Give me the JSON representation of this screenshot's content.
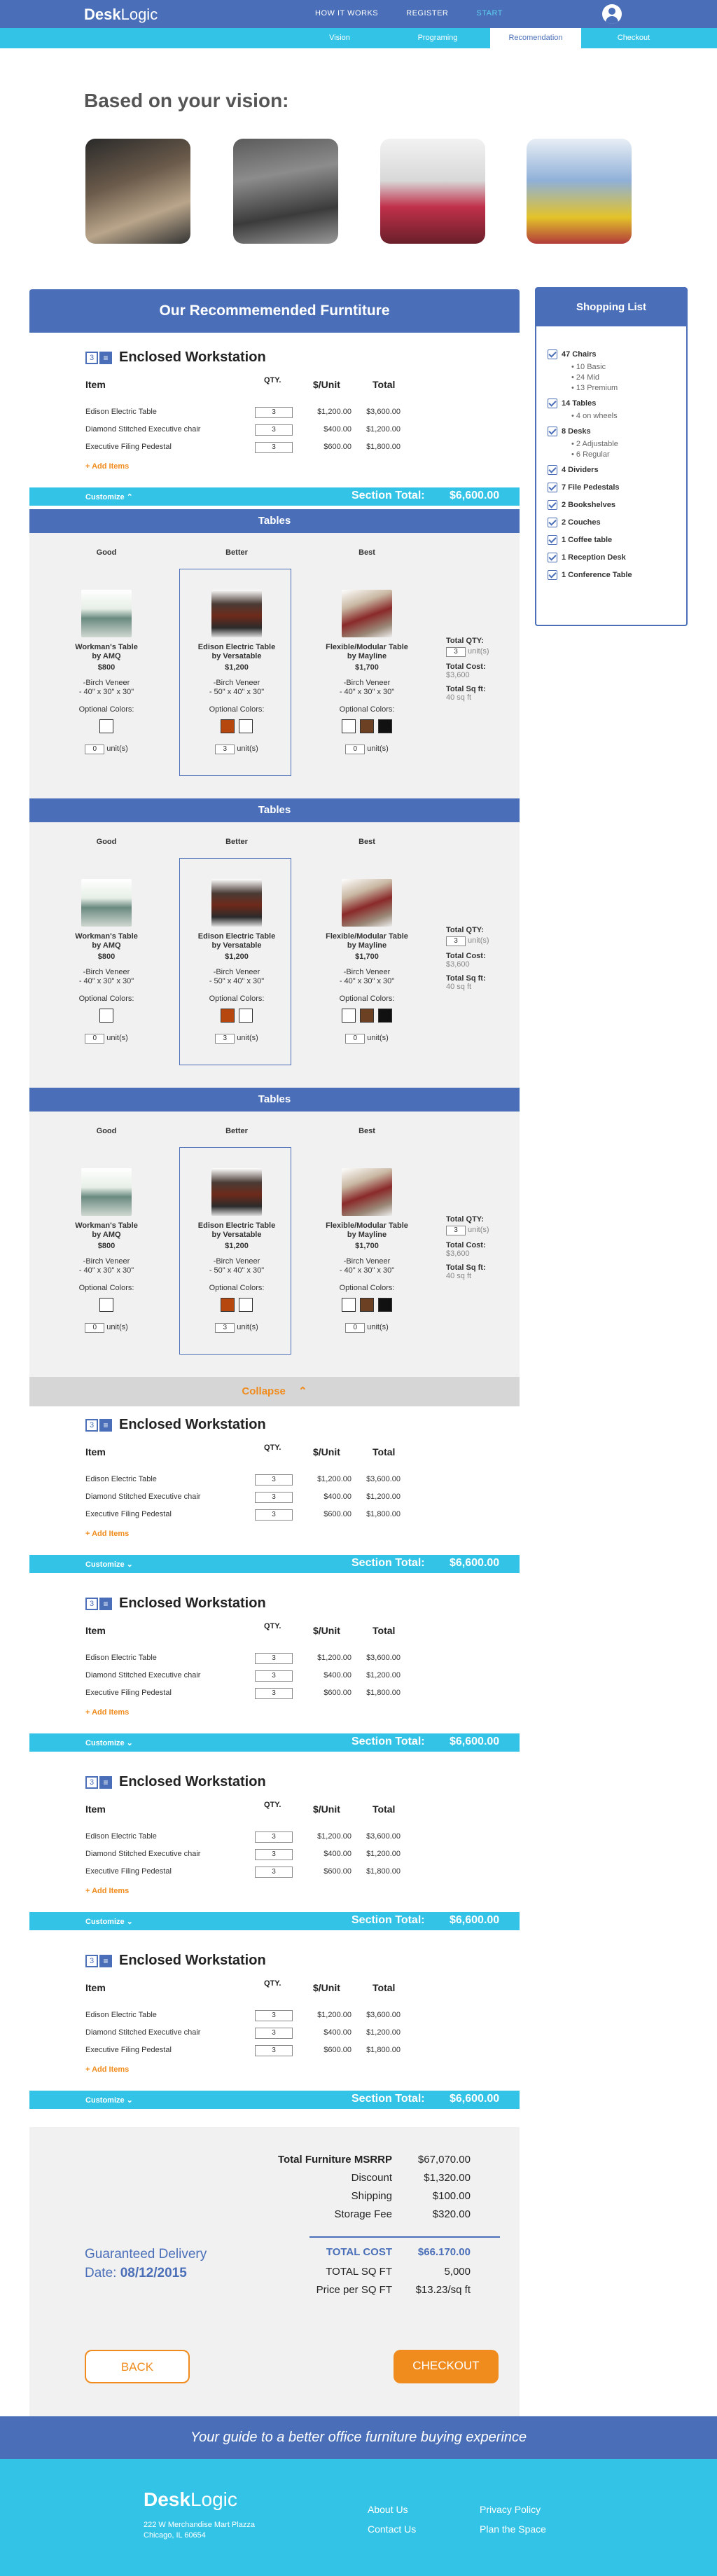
{
  "header": {
    "logo_bold": "Desk",
    "logo_rest": "Logic",
    "nav": [
      "HOW IT WORKS",
      "REGISTER",
      "START"
    ]
  },
  "steps": [
    "Vision",
    "Programing",
    "Recomendation",
    "Checkout"
  ],
  "vision": {
    "title": "Based on your vision:"
  },
  "recommend": {
    "title": "Our Recommemended Furntiture"
  },
  "workstation": {
    "qty_badge": "3",
    "title": "Enclosed Workstation",
    "headers": {
      "item": "Item",
      "qty": "QTY.",
      "unit": "$/Unit",
      "total": "Total"
    },
    "rows": [
      {
        "name": "Edison Electric Table",
        "qty": "3",
        "unit": "$1,200.00",
        "total": "$3,600.00"
      },
      {
        "name": "Diamond Stitched Executive chair",
        "qty": "3",
        "unit": "$400.00",
        "total": "$1,200.00"
      },
      {
        "name": "Executive Filing Pedestal",
        "qty": "3",
        "unit": "$600.00",
        "total": "$1,800.00"
      }
    ],
    "add": "Add Items",
    "customize": "Customize",
    "section_total_label": "Section Total:",
    "section_total": "$6,600.00"
  },
  "tables": {
    "title": "Tables",
    "options": [
      {
        "grade": "Good",
        "name1": "Workman's Table",
        "name2": "by AMQ",
        "price": "$800",
        "spec1": "-Birch Veneer",
        "spec2": "- 40\" x 30\" x 30\"",
        "colors_label": "Optional Colors:",
        "units": "0",
        "units_label": "unit(s)"
      },
      {
        "grade": "Better",
        "name1": "Edison Electric Table",
        "name2": "by Versatable",
        "price": "$1,200",
        "spec1": "-Birch Veneer",
        "spec2": "- 50\" x 40\" x 30\"",
        "colors_label": "Optional Colors:",
        "units": "3",
        "units_label": "unit(s)"
      },
      {
        "grade": "Best",
        "name1": "Flexible/Modular Table",
        "name2": "by Mayline",
        "price": "$1,700",
        "spec1": "-Birch Veneer",
        "spec2": "- 40\" x 30\" x 30\"",
        "colors_label": "Optional Colors:",
        "units": "0",
        "units_label": "unit(s)"
      }
    ],
    "totals": {
      "qty_label": "Total QTY:",
      "qty": "3",
      "qty_unit": "unit(s)",
      "cost_label": "Total Cost:",
      "cost": "$3,600",
      "sqft_label": "Total Sq ft:",
      "sqft": "40 sq ft"
    },
    "colors": {
      "brown": "#b5470f",
      "black": "#111111",
      "white": "#ffffff",
      "darkbrown": "#6b4023"
    }
  },
  "collapse": "Collapse",
  "shopping": {
    "title": "Shopping List",
    "items": [
      {
        "label": "47 Chairs",
        "subs": [
          "10 Basic",
          "24 Mid",
          "13 Premium"
        ]
      },
      {
        "label": "14 Tables",
        "subs": [
          "4 on wheels"
        ]
      },
      {
        "label": "8 Desks",
        "subs": [
          "2 Adjustable",
          "6 Regular"
        ]
      },
      {
        "label": "4 Dividers",
        "subs": []
      },
      {
        "label": "7 File Pedestals",
        "subs": []
      },
      {
        "label": "2 Bookshelves",
        "subs": []
      },
      {
        "label": "2 Couches",
        "subs": []
      },
      {
        "label": "1 Coffee table",
        "subs": []
      },
      {
        "label": "1 Reception Desk",
        "subs": []
      },
      {
        "label": "1 Conference Table",
        "subs": []
      }
    ]
  },
  "summary": {
    "msrp_label": "Total Furniture MSRRP",
    "msrp": "$67,070.00",
    "discount_label": "Discount",
    "discount": "$1,320.00",
    "shipping_label": "Shipping",
    "shipping": "$100.00",
    "storage_label": "Storage Fee",
    "storage": "$320.00",
    "cost_label": "TOTAL COST",
    "cost": "$66.170.00",
    "sqft_label": "TOTAL SQ FT",
    "sqft": "5,000",
    "pps_label": "Price per SQ FT",
    "pps": "$13.23/sq ft",
    "delivery_label": "Guaranteed Delivery",
    "date_label": "Date:",
    "date": "08/12/2015",
    "back": "BACK",
    "checkout": "CHECKOUT"
  },
  "footer": {
    "tagline": "Your guide to a better office furniture buying experince",
    "logo_bold": "Desk",
    "logo_rest": "Logic",
    "address1": "222 W Merchandise Mart Plazza",
    "address2": "Chicago, IL 60654",
    "links": [
      "About Us",
      "Contact Us",
      "Privacy Policy",
      "Plan the Space"
    ]
  }
}
